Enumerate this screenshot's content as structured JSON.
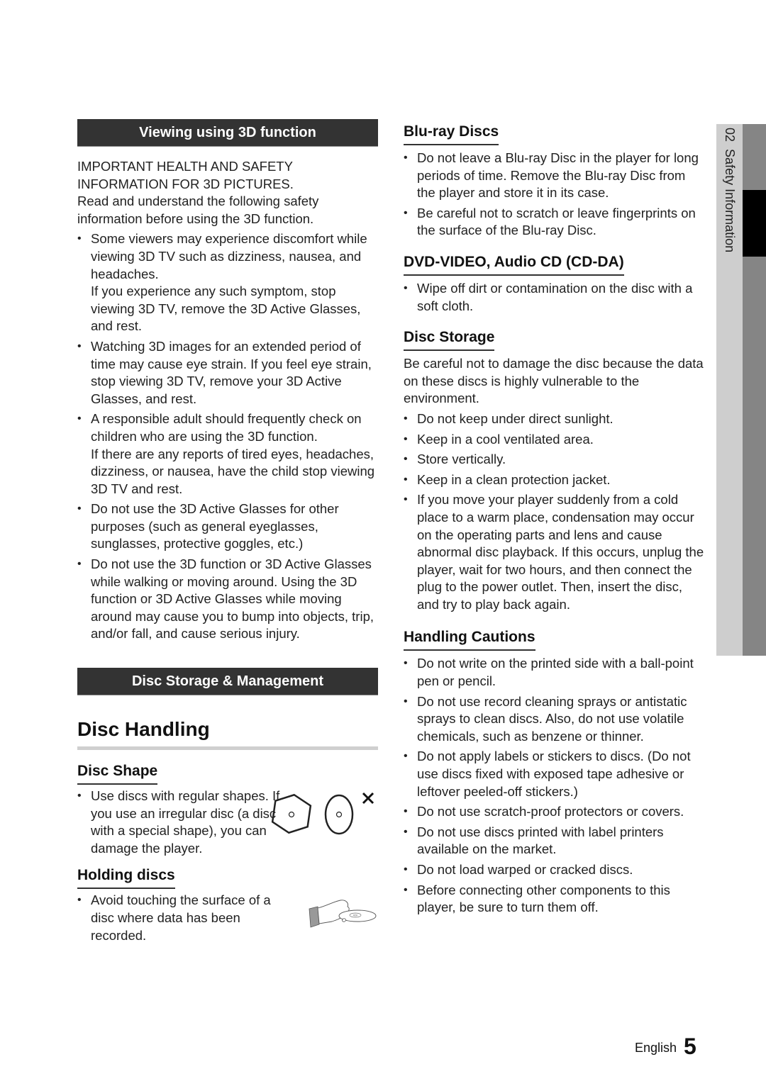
{
  "side_tab": {
    "chapter": "02",
    "label": "Safety Information"
  },
  "left": {
    "viewing_3d": {
      "title": "Viewing using 3D function",
      "intro_caps": "IMPORTANT HEALTH AND SAFETY INFORMATION FOR 3D PICTURES.",
      "intro": "Read and understand the following safety information before using the 3D function.",
      "bullets": [
        {
          "text": "Some viewers may experience discomfort while viewing 3D TV such as dizziness, nausea, and headaches.",
          "extra": "If you experience any such symptom, stop viewing 3D TV, remove the 3D Active Glasses, and rest."
        },
        {
          "text": "Watching 3D images for an extended period of time may cause eye strain. If you feel eye strain, stop viewing 3D TV, remove your 3D Active Glasses, and rest."
        },
        {
          "text": "A responsible adult should frequently check on children who are using the 3D function.",
          "extra": "If there are any reports of tired eyes, headaches, dizziness, or nausea, have the child stop viewing 3D TV and rest."
        },
        {
          "text": "Do not use the 3D Active Glasses for other purposes (such as general eyeglasses, sunglasses, protective goggles, etc.)"
        },
        {
          "text": "Do not use the 3D function or 3D Active Glasses while walking or moving around. Using the 3D function or 3D Active Glasses while moving around may cause you to bump into objects, trip, and/or fall, and cause serious injury."
        }
      ]
    },
    "disc_storage_mgmt": {
      "title": "Disc Storage & Management"
    },
    "disc_handling": {
      "title": "Disc Handling"
    },
    "disc_shape": {
      "title": "Disc Shape",
      "bullet": "Use discs with regular shapes. If you use an irregular disc (a disc with a special shape), you can damage the player.",
      "illustration": [
        "hexagon-disc-icon",
        "oval-disc-icon",
        "cross-mark-icon"
      ]
    },
    "holding_discs": {
      "title": "Holding discs",
      "bullet": "Avoid touching the surface of a disc where data has been recorded.",
      "illustration": "hand-holding-disc-icon"
    }
  },
  "right": {
    "bluray": {
      "title": "Blu-ray Discs",
      "bullets": [
        "Do not leave a Blu-ray Disc in the player for long periods of time. Remove the Blu-ray Disc from the player and store it in its case.",
        "Be careful not to scratch or leave fingerprints on the surface of the Blu-ray Disc."
      ]
    },
    "dvd": {
      "title": "DVD-VIDEO, Audio CD (CD-DA)",
      "bullets": [
        "Wipe off dirt or contamination on the disc with a soft cloth."
      ]
    },
    "storage": {
      "title": "Disc Storage",
      "intro": "Be careful not to damage the disc because the data on these discs is highly vulnerable to the environment.",
      "bullets": [
        "Do not keep under direct sunlight.",
        "Keep in a cool ventilated area.",
        "Store vertically.",
        "Keep in a clean protection jacket.",
        "If you move your player suddenly from a cold place to a warm place, condensation may occur on the operating parts and lens and cause abnormal disc playback. If this occurs, unplug the player, wait for two hours, and then connect the plug to the power outlet. Then, insert the disc, and try to play back again."
      ]
    },
    "cautions": {
      "title": "Handling Cautions",
      "bullets": [
        "Do not write on the printed side with a ball-point pen or pencil.",
        "Do not use record cleaning sprays or antistatic sprays to clean discs. Also, do not use volatile chemicals, such as benzene or thinner.",
        "Do not apply labels or stickers to discs. (Do not use discs fixed with exposed tape adhesive or leftover peeled-off stickers.)",
        "Do not use scratch-proof protectors or covers.",
        "Do not use discs printed with label printers available on the market.",
        "Do not load warped or cracked discs.",
        "Before connecting other components to this player, be sure to turn them off."
      ]
    }
  },
  "footer": {
    "language": "English",
    "page_number": "5"
  }
}
